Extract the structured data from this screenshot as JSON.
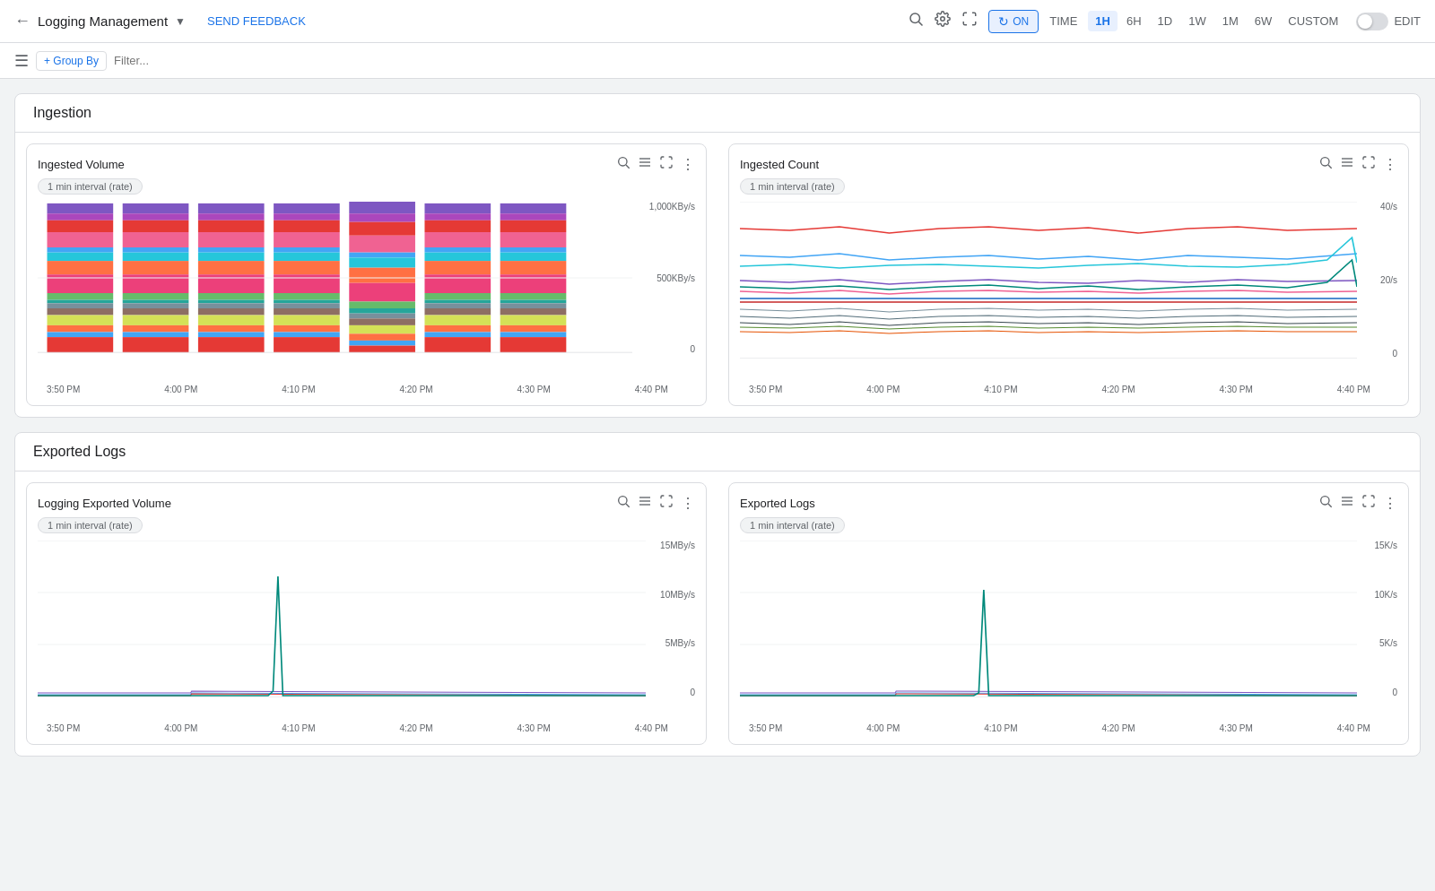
{
  "header": {
    "back_label": "←",
    "title": "Logging Management",
    "dropdown_icon": "▾",
    "send_feedback": "SEND FEEDBACK",
    "icons": [
      "search",
      "settings",
      "fullscreen"
    ],
    "refresh": {
      "icon": "↻",
      "label": "ON"
    },
    "time_label": "TIME",
    "time_options": [
      "1H",
      "6H",
      "1D",
      "1W",
      "1M",
      "6W",
      "CUSTOM"
    ],
    "active_time": "1H",
    "edit_label": "EDIT"
  },
  "toolbar": {
    "group_by_label": "+ Group By",
    "filter_placeholder": "Filter..."
  },
  "sections": [
    {
      "id": "ingestion",
      "title": "Ingestion",
      "charts": [
        {
          "id": "ingested-volume",
          "title": "Ingested Volume",
          "interval": "1 min interval (rate)",
          "type": "bar",
          "y_labels": [
            "1,000KBy/s",
            "500KBy/s",
            "0"
          ],
          "x_labels": [
            "3:50 PM",
            "4:00 PM",
            "4:10 PM",
            "4:20 PM",
            "4:30 PM",
            "4:40 PM"
          ]
        },
        {
          "id": "ingested-count",
          "title": "Ingested Count",
          "interval": "1 min interval (rate)",
          "type": "line",
          "y_labels": [
            "40/s",
            "20/s",
            "0"
          ],
          "x_labels": [
            "3:50 PM",
            "4:00 PM",
            "4:10 PM",
            "4:20 PM",
            "4:30 PM",
            "4:40 PM"
          ]
        }
      ]
    },
    {
      "id": "exported-logs",
      "title": "Exported Logs",
      "charts": [
        {
          "id": "logging-exported-volume",
          "title": "Logging Exported Volume",
          "interval": "1 min interval (rate)",
          "type": "line-sparse",
          "y_labels": [
            "15MBy/s",
            "10MBy/s",
            "5MBy/s",
            "0"
          ],
          "x_labels": [
            "3:50 PM",
            "4:00 PM",
            "4:10 PM",
            "4:20 PM",
            "4:30 PM",
            "4:40 PM"
          ]
        },
        {
          "id": "exported-logs",
          "title": "Exported Logs",
          "interval": "1 min interval (rate)",
          "type": "line-sparse",
          "y_labels": [
            "15K/s",
            "10K/s",
            "5K/s",
            "0"
          ],
          "x_labels": [
            "3:50 PM",
            "4:00 PM",
            "4:10 PM",
            "4:20 PM",
            "4:30 PM",
            "4:40 PM"
          ]
        }
      ]
    }
  ],
  "colors": {
    "primary": "#1a73e8",
    "active_tab_bg": "#e8f0fe",
    "bar_colors": [
      "#e53935",
      "#f06292",
      "#ab47bc",
      "#7e57c2",
      "#42a5f5",
      "#26c6da",
      "#26a69a",
      "#66bb6a",
      "#d4e157",
      "#ff7043",
      "#8d6e63",
      "#78909c",
      "#ec407a",
      "#5c6bc0",
      "#29b6f6",
      "#00acc1"
    ],
    "line_colors": [
      "#e53935",
      "#42a5f5",
      "#ab47bc",
      "#00897b",
      "#7e57c2",
      "#f06292",
      "#1565c0",
      "#00695c",
      "#558b2f",
      "#e65100",
      "#6a1b9a",
      "#37474f"
    ]
  }
}
